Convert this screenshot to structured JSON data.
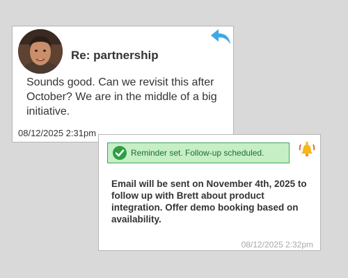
{
  "email": {
    "subject": "Re: partnership",
    "body": "Sounds good. Can we revisit this after October? We are in the middle of a big initiative.",
    "timestamp": "08/12/2025  2:31pm",
    "reply_icon": "reply-arrow-icon",
    "avatar": "sender-avatar"
  },
  "reminder": {
    "banner_text": "Reminder set. Follow-up scheduled.",
    "banner_icon": "check-circle-icon",
    "bell_icon": "ringing-bell-icon",
    "body": "Email will be sent on November 4th, 2025 to follow up with Brett about product integration. Offer demo booking based on availability.",
    "timestamp": "08/12/2025  2:32pm"
  },
  "colors": {
    "background": "#d9d9d9",
    "reply_icon": "#3da9e6",
    "banner_bg": "#c6efc6",
    "banner_border": "#3fa55a",
    "check": "#2e9e44",
    "bell": "#f5b81c"
  }
}
